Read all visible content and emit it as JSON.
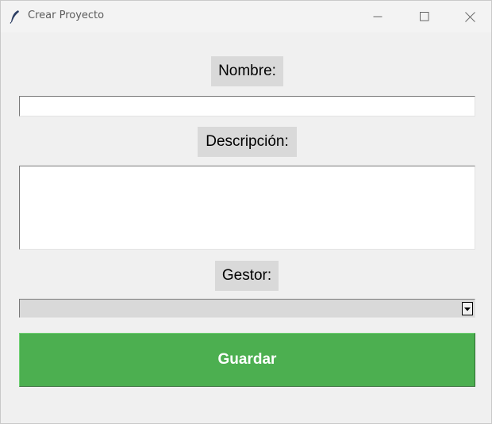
{
  "window": {
    "title": "Crear Proyecto",
    "app_icon": "feather-icon",
    "controls": [
      "minimize-icon",
      "maximize-icon",
      "close-icon"
    ]
  },
  "form": {
    "nombre_label": "Nombre:",
    "nombre_value": "",
    "descripcion_label": "Descripción:",
    "descripcion_value": "",
    "gestor_label": "Gestor:",
    "gestor_value": "",
    "save_label": "Guardar"
  },
  "colors": {
    "save_button": "#4caf50",
    "label_background": "#d9d9d9",
    "window_background": "#f0f0f0"
  }
}
